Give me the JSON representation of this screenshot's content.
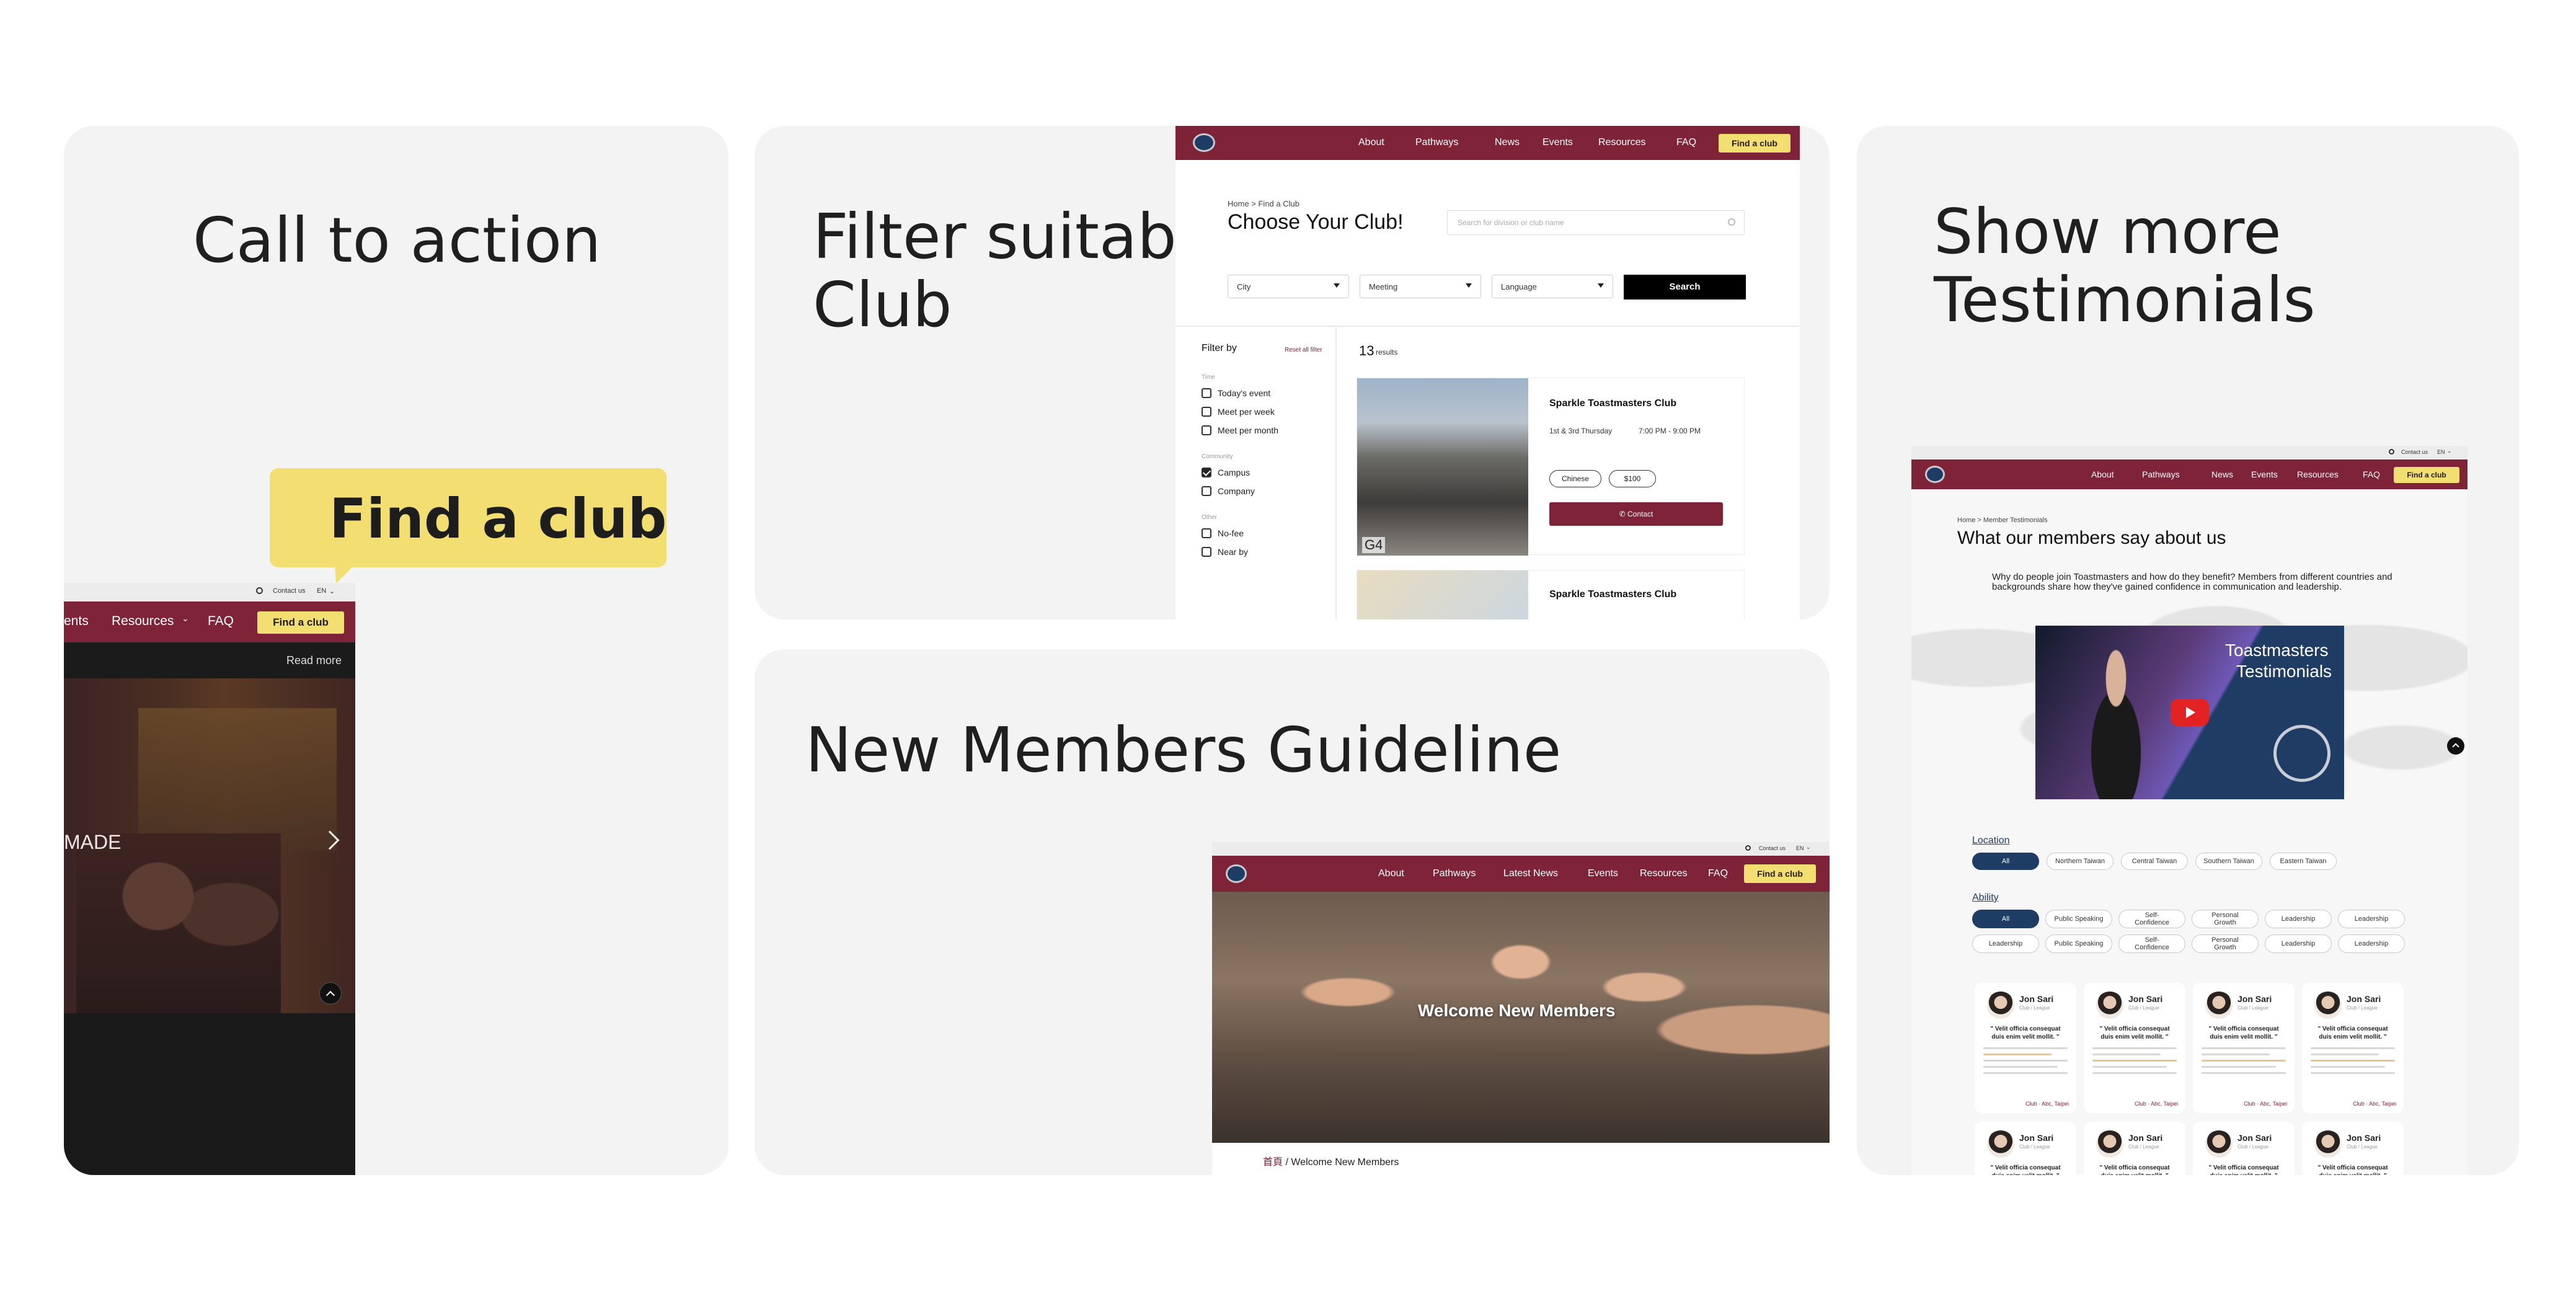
{
  "colors": {
    "brand": "#7e2338",
    "accent_yellow": "#f3de72",
    "navy": "#1f3c64",
    "panel_bg": "#f3f3f3"
  },
  "panels": {
    "cta": {
      "title": "Call to action",
      "callout": "Find a club"
    },
    "filter": {
      "title_line1": "Filter suitable",
      "title_line2": "Club"
    },
    "guideline": {
      "title": "New Members Guideline"
    },
    "testimonials": {
      "title_line1": "Show more",
      "title_line2": "Testimonials"
    }
  },
  "cta_screen": {
    "topbar": {
      "contact": "Contact us",
      "lang": "EN"
    },
    "nav": [
      "ents",
      "Resources",
      "FAQ"
    ],
    "find_club": "Find a club",
    "read_more": "Read more",
    "hero_text": "MADE",
    "next_icon": "chevron-right-icon",
    "up_icon": "chevron-up-icon"
  },
  "filter_screen": {
    "nav": [
      "About",
      "Pathways",
      "News",
      "Events",
      "Resources",
      "FAQ"
    ],
    "find_club": "Find a club",
    "breadcrumb": "Home > Find a Club",
    "heading": "Choose Your Club!",
    "search_placeholder": "Search for division or club name",
    "selects": [
      "City",
      "Meeting",
      "Language"
    ],
    "search_button": "Search",
    "filter_by": "Filter by",
    "reset": "Reset all filter",
    "groups": [
      {
        "label": "Time",
        "items": [
          {
            "text": "Today's event",
            "checked": false
          },
          {
            "text": "Meet per week",
            "checked": false
          },
          {
            "text": "Meet per month",
            "checked": false
          }
        ]
      },
      {
        "label": "Community",
        "items": [
          {
            "text": "Campus",
            "checked": true
          },
          {
            "text": "Company",
            "checked": false
          }
        ]
      },
      {
        "label": "Other",
        "items": [
          {
            "text": "No-fee",
            "checked": false
          },
          {
            "text": "Near by",
            "checked": false
          }
        ]
      }
    ],
    "results_count": "13",
    "results_label": "results",
    "clubs": [
      {
        "name": "Sparkle Toastmasters Club",
        "schedule": "1st & 3rd Thursday",
        "time": "7:00 PM - 9:00 PM",
        "tags": [
          "Chinese",
          "$100"
        ],
        "contact": "Contact",
        "photo_tag": "G4"
      },
      {
        "name": "Sparkle Toastmasters Club"
      }
    ]
  },
  "guideline_screen": {
    "topbar": {
      "contact": "Contact us",
      "lang": "EN"
    },
    "nav": [
      "About",
      "Pathways",
      "Latest News",
      "Events",
      "Resources",
      "FAQ"
    ],
    "find_club": "Find a club",
    "hero_title": "Welcome New Members",
    "breadcrumb_home": "首頁",
    "breadcrumb_current": "/ Welcome New Members"
  },
  "testimonial_screen": {
    "topbar": {
      "contact": "Contact us",
      "lang": "EN"
    },
    "nav": [
      "About",
      "Pathways",
      "News",
      "Events",
      "Resources",
      "FAQ"
    ],
    "find_club": "Find a club",
    "breadcrumb": "Home > Member Testimonials",
    "heading": "What our members say about us",
    "intro": "Why do people join Toastmasters and how do they benefit? Members from different countries and backgrounds share how they've gained confidence in communication and leadership.",
    "video_title_line1": "Toastmasters",
    "video_title_line2": "Testimonials",
    "location_label": "Location",
    "locations": [
      "All",
      "Northern Taiwan",
      "Central Taiwan",
      "Southern Taiwan",
      "Eastern Taiwan"
    ],
    "ability_label": "Ability",
    "abilities_row1": [
      "All",
      "Public Speaking",
      "Self-\nConfidence",
      "Personal\nGrowth",
      "Leadership",
      "Leadership"
    ],
    "abilities_row2": [
      "Leadership",
      "Public Speaking",
      "Self-\nConfidence",
      "Personal\nGrowth",
      "Leadership",
      "Leadership"
    ],
    "card": {
      "name": "Jon Sari",
      "sub": "Club / League",
      "quote": "\" Velit officia consequat duis enim velit mollit. \"",
      "location": "Club · Abc, Taipei"
    }
  }
}
